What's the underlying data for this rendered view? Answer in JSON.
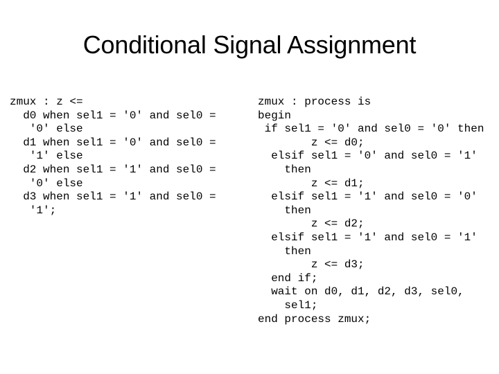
{
  "slide": {
    "title": "Conditional Signal Assignment",
    "background_color": "#ffffff",
    "text_color": "#000000"
  },
  "code_blocks": {
    "left": {
      "name": "conditional-signal-assignment-code",
      "lines": [
        "zmux : z <=",
        "  d0 when sel1 = '0' and sel0 =",
        "   '0' else",
        "  d1 when sel1 = '0' and sel0 =",
        "   '1' else",
        "  d2 when sel1 = '1' and sel0 =",
        "   '0' else",
        "  d3 when sel1 = '1' and sel0 =",
        "   '1';"
      ]
    },
    "right": {
      "name": "equivalent-process-code",
      "lines": [
        "zmux : process is",
        "begin",
        " if sel1 = '0' and sel0 = '0' then",
        "        z <= d0;",
        "  elsif sel1 = '0' and sel0 = '1'",
        "    then",
        "        z <= d1;",
        "  elsif sel1 = '1' and sel0 = '0'",
        "    then",
        "        z <= d2;",
        "  elsif sel1 = '1' and sel0 = '1'",
        "    then",
        "        z <= d3;",
        "  end if;",
        "  wait on d0, d1, d2, d3, sel0,",
        "    sel1;",
        "end process zmux;"
      ]
    }
  }
}
